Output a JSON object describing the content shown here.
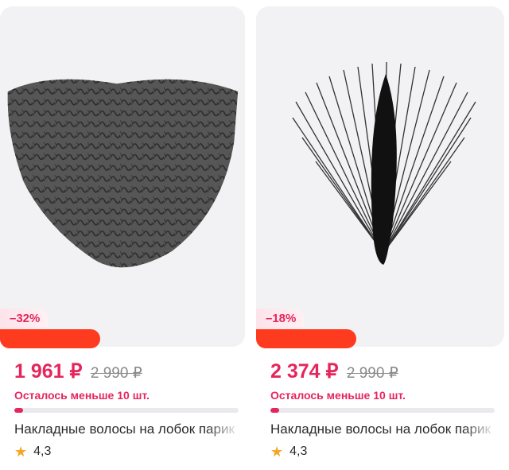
{
  "products": [
    {
      "discount": "–32%",
      "price_now": "1 961 ₽",
      "price_old": "2 990 ₽",
      "stock_text": "Осталось меньше 10 шт.",
      "stock_level": 0.04,
      "title": "Накладные волосы на лобок парик",
      "rating": "4,3",
      "image_icon": "curly-hair-patch-image"
    },
    {
      "discount": "–18%",
      "price_now": "2 374 ₽",
      "price_old": "2 990 ₽",
      "stock_text": "Осталось меньше 10 шт.",
      "stock_level": 0.04,
      "title": "Накладные волосы на лобок парик",
      "rating": "4,3",
      "image_icon": "straight-hair-patch-image"
    }
  ],
  "colors": {
    "accent": "#e5265c",
    "promo": "#ff3b1f",
    "star": "#f5a623"
  }
}
